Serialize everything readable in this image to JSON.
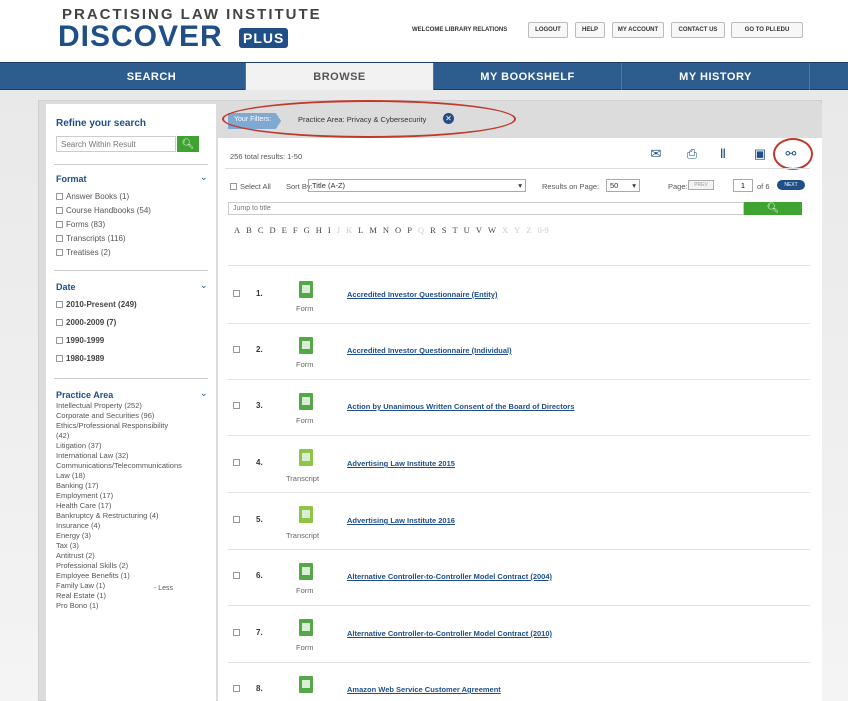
{
  "header": {
    "logo_top": "PRACTISING LAW INSTITUTE",
    "logo_main": "DISCOVER",
    "logo_plus": "PLUS",
    "welcome": "WELCOME LIBRARY RELATIONS",
    "links": [
      "LOGOUT",
      "HELP",
      "MY ACCOUNT",
      "CONTACT US",
      "GO TO PLI.EDU"
    ]
  },
  "nav": {
    "tabs": [
      "SEARCH",
      "BROWSE",
      "MY BOOKSHELF",
      "MY HISTORY"
    ],
    "active": "BROWSE"
  },
  "sidebar": {
    "refine_title": "Refine your search",
    "refine_placeholder": "Search Within Result",
    "format": {
      "heading": "Format",
      "items": [
        "Answer Books (1)",
        "Course Handbooks (54)",
        "Forms (83)",
        "Transcripts (116)",
        "Treatises (2)"
      ]
    },
    "date": {
      "heading": "Date",
      "items": [
        "2010-Present (249)",
        "2000-2009 (7)",
        "1990-1999",
        "1980-1989"
      ]
    },
    "practice_area": {
      "heading": "Practice Area",
      "items": [
        "Intellectual Property (252)",
        "Corporate and Securities (96)",
        "Ethics/Professional Responsibility",
        "(42)",
        "Litigation (37)",
        "International Law (32)",
        "Communications/Telecommunications",
        "Law (18)",
        "Banking (17)",
        "Employment (17)",
        "Health Care (17)",
        "Bankruptcy & Restructuring (4)",
        "Insurance (4)",
        "Energy (3)",
        "Tax (3)",
        "Antitrust (2)",
        "Professional Skills (2)",
        "Employee Benefits (1)",
        "Family Law (1)",
        "Real Estate (1)",
        "Pro Bono (1)"
      ],
      "less": "- Less"
    }
  },
  "filters": {
    "label": "Your Filters:",
    "active": "Practice Area: Privacy & Cybersecurity"
  },
  "results": {
    "total": "256 total results: 1-50",
    "select_all": "Select All",
    "sort_label": "Sort By:",
    "sort_value": "Title (A-Z)",
    "rpp_label": "Results on Page:",
    "rpp_value": "50",
    "page_label": "Page:",
    "prev": "PREV",
    "page_value": "1",
    "page_of": "of 6",
    "next": "NEXT",
    "jump_placeholder": "Jump to title",
    "alphabet": [
      "A",
      "B",
      "C",
      "D",
      "E",
      "F",
      "G",
      "H",
      "I",
      "J",
      "K",
      "L",
      "M",
      "N",
      "O",
      "P",
      "Q",
      "R",
      "S",
      "T",
      "U",
      "V",
      "W",
      "X",
      "Y",
      "Z",
      "0-9"
    ],
    "alphabet_disabled": [
      "J",
      "K",
      "Q",
      "X",
      "Y",
      "Z",
      "0-9"
    ],
    "rows": [
      {
        "num": "1.",
        "type": "Form",
        "title": "Accredited Investor Questionnaire (Entity)"
      },
      {
        "num": "2.",
        "type": "Form",
        "title": "Accredited Investor Questionnaire (Individual)"
      },
      {
        "num": "3.",
        "type": "Form",
        "title": "Action by Unanimous Written Consent of the Board of Directors"
      },
      {
        "num": "4.",
        "type": "Transcript",
        "title": "Advertising Law Institute 2015"
      },
      {
        "num": "5.",
        "type": "Transcript",
        "title": "Advertising Law Institute 2016"
      },
      {
        "num": "6.",
        "type": "Form",
        "title": "Alternative Controller-to-Controller Model Contract (2004)"
      },
      {
        "num": "7.",
        "type": "Form",
        "title": "Alternative Controller-to-Controller Model Contract (2010)"
      },
      {
        "num": "8.",
        "type": "Form",
        "title": "Amazon Web Service Customer Agreement"
      }
    ]
  },
  "colors": {
    "brand_blue": "#1f4f86",
    "nav_blue": "#2d5c8f",
    "green": "#3ea331",
    "highlight_red": "#c0392b"
  },
  "icons": [
    "search-icon",
    "email-icon",
    "print-icon",
    "bookshelf-icon",
    "save-icon",
    "link-icon",
    "close-icon",
    "chevron-down-icon",
    "form-document-icon",
    "transcript-document-icon"
  ]
}
